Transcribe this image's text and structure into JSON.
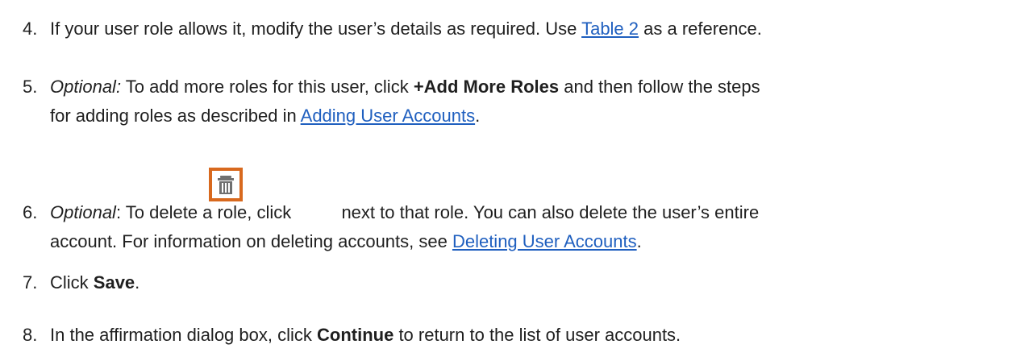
{
  "steps": [
    {
      "number": "4.",
      "text_a": "If your user role allows it, modify the user’s details as required. Use ",
      "link": "Table 2",
      "text_b": " as a reference."
    },
    {
      "number": "5.",
      "italic": "Optional:",
      "text_a": " To add more roles for this user, click ",
      "bold": "+Add More Roles",
      "text_b": " and then follow the steps",
      "line2_a": "for adding roles as described in ",
      "link": "Adding User Accounts",
      "line2_b": "."
    },
    {
      "number": "6.",
      "italic": "Optional",
      "text_a": ": To delete a role, click ",
      "icon": "trash-icon",
      "text_b": " next to that role. You can also delete the user’s entire",
      "line2_a": "account. For information on deleting accounts, see ",
      "link": "Deleting User Accounts",
      "line2_b": "."
    },
    {
      "number": "7.",
      "text_a": "Click ",
      "bold": "Save",
      "text_b": "."
    },
    {
      "number": "8.",
      "text_a": "In the affirmation dialog box, click ",
      "bold": "Continue",
      "text_b": " to return to the list of user accounts."
    }
  ],
  "colors": {
    "link": "#1f5fbf",
    "icon_border": "#d8691e",
    "icon_glyph": "#6f6f6f"
  }
}
